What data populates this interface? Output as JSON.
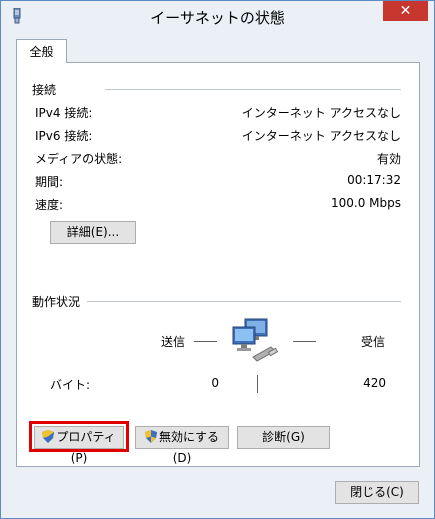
{
  "window": {
    "title": "イーサネットの状態",
    "close_glyph": "✕"
  },
  "tabs": [
    {
      "label": "全般"
    }
  ],
  "connection": {
    "section_title": "接続",
    "rows": [
      {
        "label": "IPv4 接続:",
        "value": "インターネット アクセスなし"
      },
      {
        "label": "IPv6 接続:",
        "value": "インターネット アクセスなし"
      },
      {
        "label": "メディアの状態:",
        "value": "有効"
      },
      {
        "label": "期間:",
        "value": "00:17:32"
      },
      {
        "label": "速度:",
        "value": "100.0 Mbps"
      }
    ],
    "details_button": "詳細(E)..."
  },
  "activity": {
    "section_title": "動作状況",
    "sent_label": "送信",
    "received_label": "受信",
    "bytes_label": "バイト:",
    "bytes_sent": "0",
    "bytes_received": "420"
  },
  "actions": {
    "properties_button": "プロパティ(P)",
    "disable_button": "無効にする(D)",
    "diagnose_button": "診断(G)"
  },
  "footer": {
    "close_button": "閉じる(C)"
  },
  "colors": {
    "highlight": "#e00000",
    "title_close": "#c7372f"
  },
  "icons": [
    "network-adapter-icon",
    "shield-icon",
    "network-computers-icon"
  ]
}
